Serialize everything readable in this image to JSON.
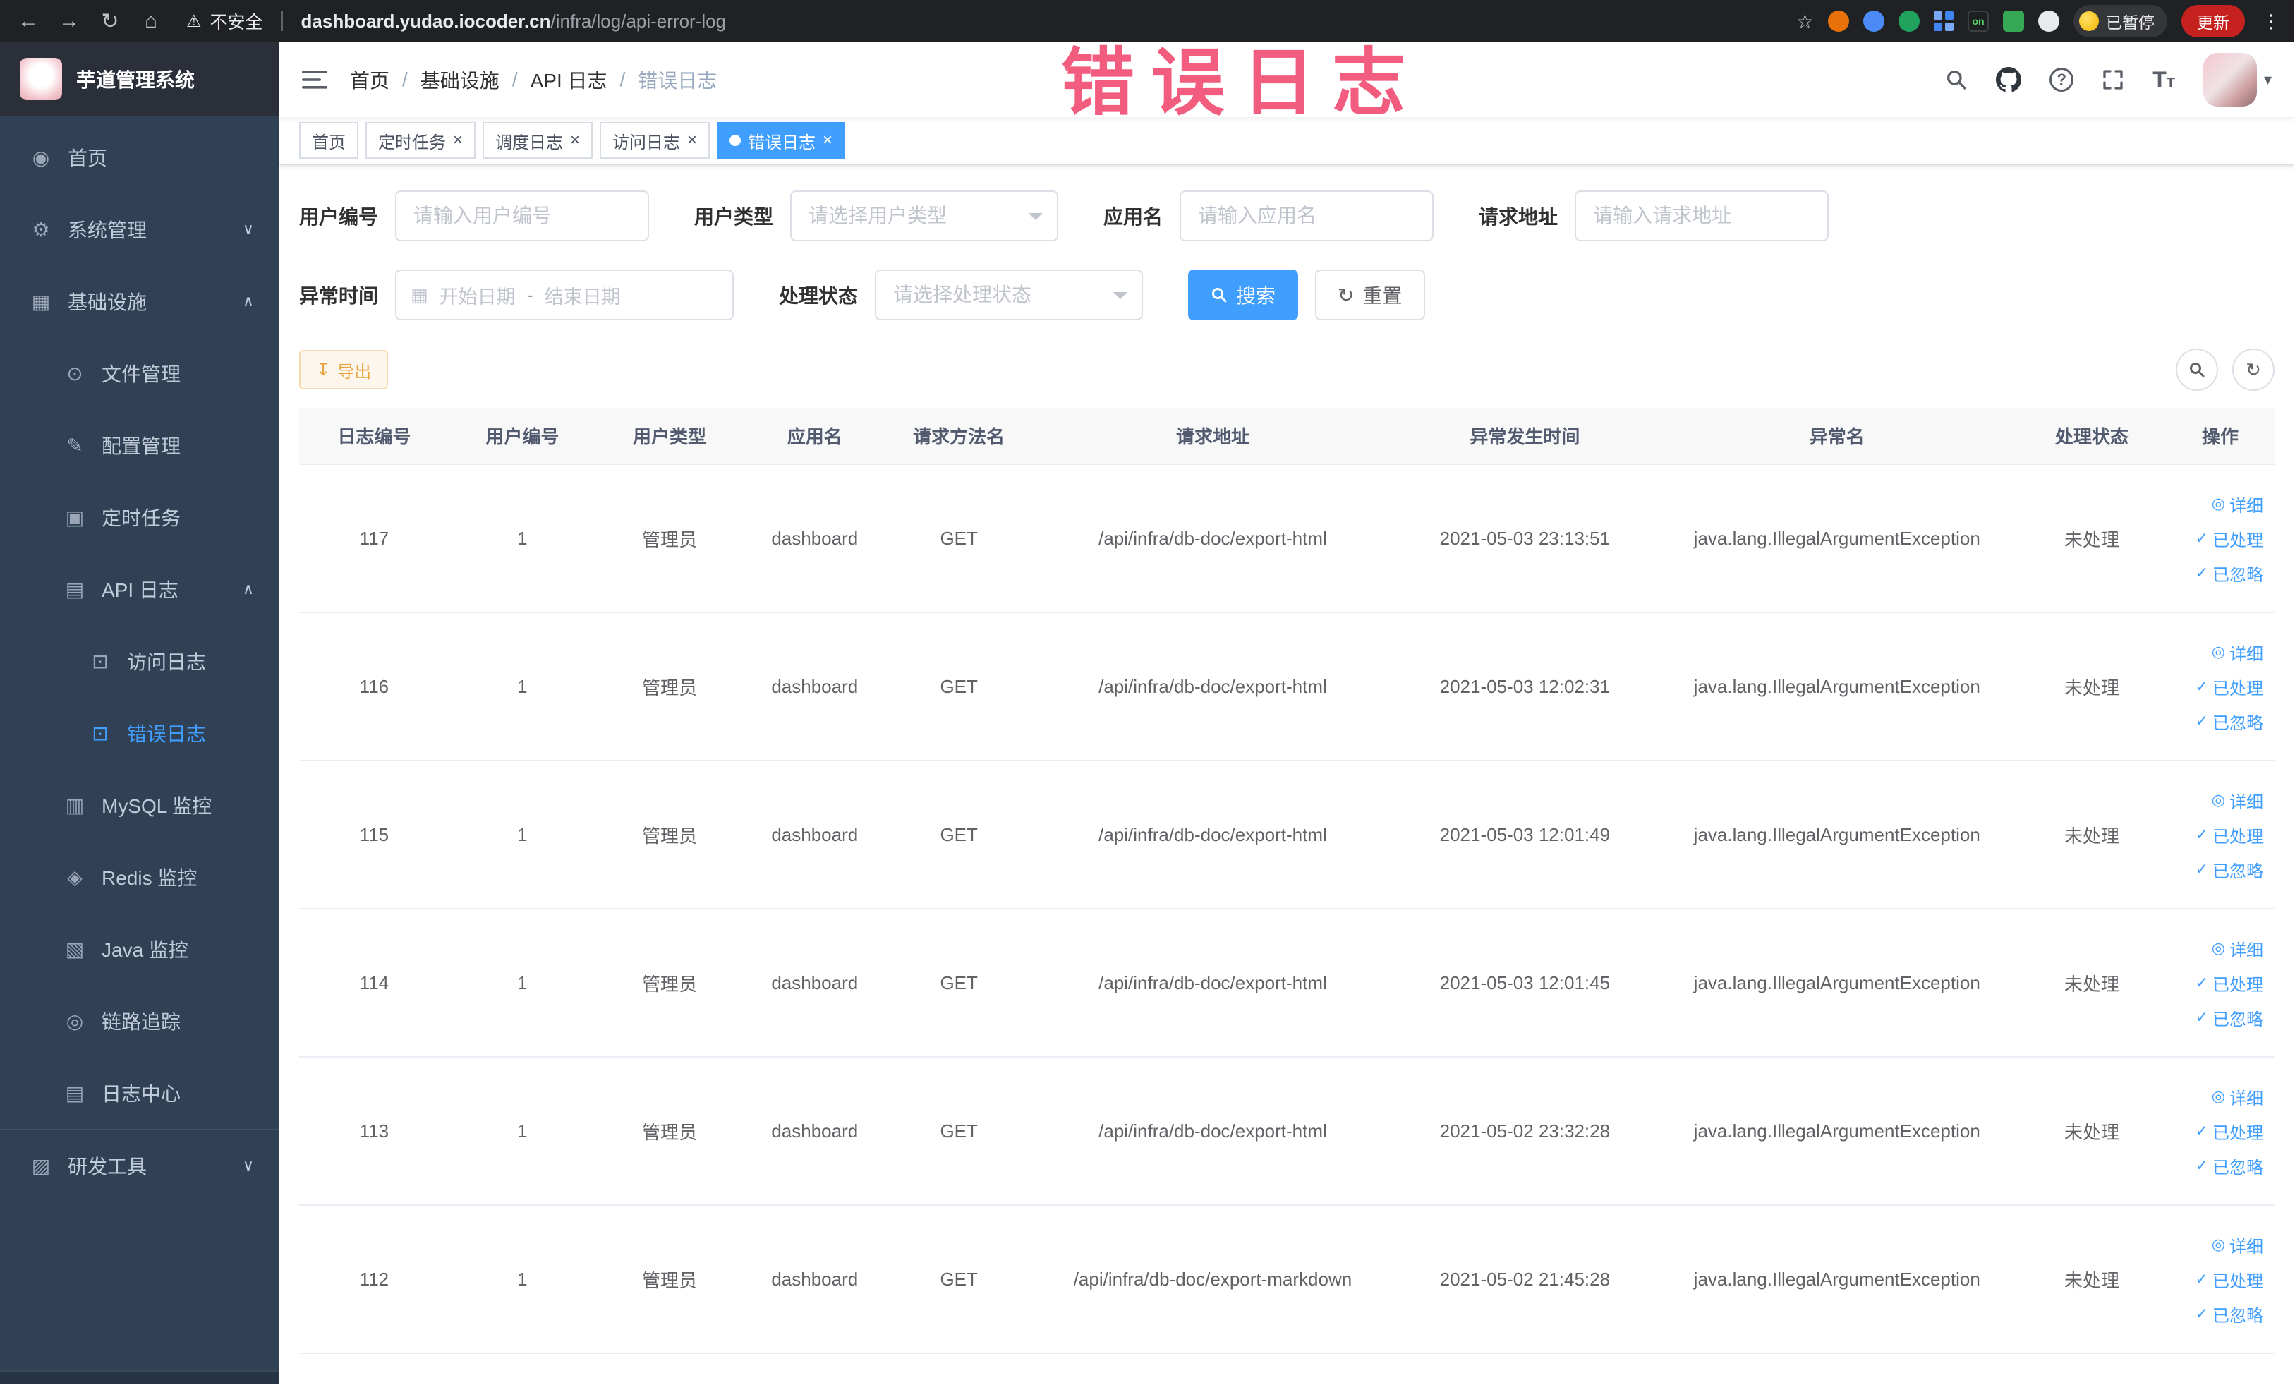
{
  "browser": {
    "security_label": "不安全",
    "url_host": "dashboard.yudao.iocoder.cn",
    "url_path": "/infra/log/api-error-log",
    "profile_badge": "已暂停",
    "update_label": "更新",
    "ext_on": "on"
  },
  "overlay": {
    "title": "错误日志"
  },
  "sidebar": {
    "logo_title": "芋道管理系统",
    "items": [
      {
        "label": "首页"
      },
      {
        "label": "系统管理"
      },
      {
        "label": "基础设施"
      },
      {
        "label": "文件管理"
      },
      {
        "label": "配置管理"
      },
      {
        "label": "定时任务"
      },
      {
        "label": "API 日志"
      },
      {
        "label": "访问日志"
      },
      {
        "label": "错误日志"
      },
      {
        "label": "MySQL 监控"
      },
      {
        "label": "Redis 监控"
      },
      {
        "label": "Java 监控"
      },
      {
        "label": "链路追踪"
      },
      {
        "label": "日志中心"
      },
      {
        "label": "研发工具"
      }
    ]
  },
  "breadcrumb": {
    "items": [
      "首页",
      "基础设施",
      "API 日志",
      "错误日志"
    ],
    "separator": "/"
  },
  "tabs": [
    {
      "label": "首页"
    },
    {
      "label": "定时任务"
    },
    {
      "label": "调度日志"
    },
    {
      "label": "访问日志"
    },
    {
      "label": "错误日志"
    }
  ],
  "filters": {
    "user_id": {
      "label": "用户编号",
      "placeholder": "请输入用户编号"
    },
    "user_type": {
      "label": "用户类型",
      "placeholder": "请选择用户类型"
    },
    "app_name": {
      "label": "应用名",
      "placeholder": "请输入应用名"
    },
    "request_url": {
      "label": "请求地址",
      "placeholder": "请输入请求地址"
    },
    "exception_time": {
      "label": "异常时间",
      "start": "开始日期",
      "separator": "-",
      "end": "结束日期"
    },
    "process_status": {
      "label": "处理状态",
      "placeholder": "请选择处理状态"
    },
    "search": "搜索",
    "reset": "重置"
  },
  "toolbar": {
    "export": "导出"
  },
  "table": {
    "columns": [
      "日志编号",
      "用户编号",
      "用户类型",
      "应用名",
      "请求方法名",
      "请求地址",
      "异常发生时间",
      "异常名",
      "处理状态",
      "操作"
    ],
    "actions": {
      "detail": "详细",
      "process": "已处理",
      "ignore": "已忽略"
    },
    "rows": [
      {
        "id": "117",
        "user_id": "1",
        "user_type": "管理员",
        "app": "dashboard",
        "method": "GET",
        "url": "/api/infra/db-doc/export-html",
        "time": "2021-05-03 23:13:51",
        "exception": "java.lang.IllegalArgumentException",
        "status": "未处理"
      },
      {
        "id": "116",
        "user_id": "1",
        "user_type": "管理员",
        "app": "dashboard",
        "method": "GET",
        "url": "/api/infra/db-doc/export-html",
        "time": "2021-05-03 12:02:31",
        "exception": "java.lang.IllegalArgumentException",
        "status": "未处理"
      },
      {
        "id": "115",
        "user_id": "1",
        "user_type": "管理员",
        "app": "dashboard",
        "method": "GET",
        "url": "/api/infra/db-doc/export-html",
        "time": "2021-05-03 12:01:49",
        "exception": "java.lang.IllegalArgumentException",
        "status": "未处理"
      },
      {
        "id": "114",
        "user_id": "1",
        "user_type": "管理员",
        "app": "dashboard",
        "method": "GET",
        "url": "/api/infra/db-doc/export-html",
        "time": "2021-05-03 12:01:45",
        "exception": "java.lang.IllegalArgumentException",
        "status": "未处理"
      },
      {
        "id": "113",
        "user_id": "1",
        "user_type": "管理员",
        "app": "dashboard",
        "method": "GET",
        "url": "/api/infra/db-doc/export-html",
        "time": "2021-05-02 23:32:28",
        "exception": "java.lang.IllegalArgumentException",
        "status": "未处理"
      },
      {
        "id": "112",
        "user_id": "1",
        "user_type": "管理员",
        "app": "dashboard",
        "method": "GET",
        "url": "/api/infra/db-doc/export-markdown",
        "time": "2021-05-02 21:45:28",
        "exception": "java.lang.IllegalArgumentException",
        "status": "未处理"
      }
    ]
  },
  "icons": {
    "back": "←",
    "forward": "→",
    "reload": "↻",
    "home": "⌂",
    "warning": "⚠",
    "star": "☆",
    "kebab": "⋮",
    "menu_home": "◉",
    "menu_system": "⚙",
    "menu_infra": "▦",
    "menu_file": "⊙",
    "menu_config": "✎",
    "menu_task": "▣",
    "menu_api_log": "▤",
    "menu_access_log": "⊡",
    "menu_error_log": "⊡",
    "menu_mysql": "▥",
    "menu_redis": "◈",
    "menu_java": "▧",
    "menu_trace": "◎",
    "menu_log_center": "▤",
    "menu_devtools": "▨",
    "chevron_down": "∨",
    "chevron_up": "∧",
    "caret_down": "▾",
    "calendar": "▦",
    "refresh": "↻",
    "download": "↧",
    "eye": "◎",
    "check": "✓",
    "close": "×",
    "question": "?",
    "font_size": "T"
  }
}
